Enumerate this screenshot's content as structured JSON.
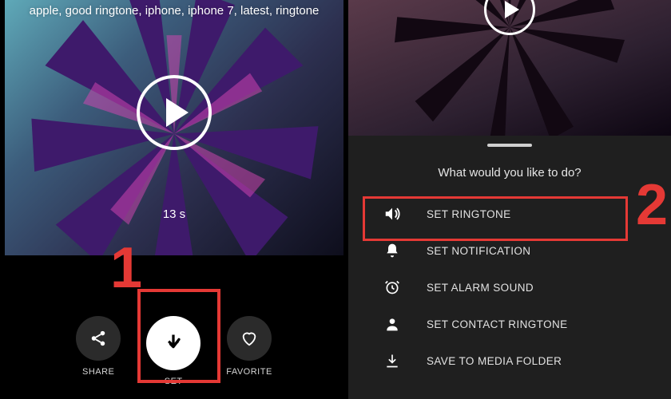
{
  "left": {
    "tags": "apple, good ringtone, iphone, iphone 7, latest, ringtone",
    "duration": "13 s",
    "actions": {
      "share": "SHARE",
      "set": "SET",
      "favorite": "FAVORITE"
    },
    "step_number": "1"
  },
  "right": {
    "sheet_title": "What would you like to do?",
    "options": {
      "set_ringtone": "SET RINGTONE",
      "set_notification": "SET NOTIFICATION",
      "set_alarm": "SET ALARM SOUND",
      "set_contact": "SET CONTACT RINGTONE",
      "save_media": "SAVE TO MEDIA FOLDER"
    },
    "step_number": "2"
  },
  "colors": {
    "highlight": "#e53935"
  }
}
